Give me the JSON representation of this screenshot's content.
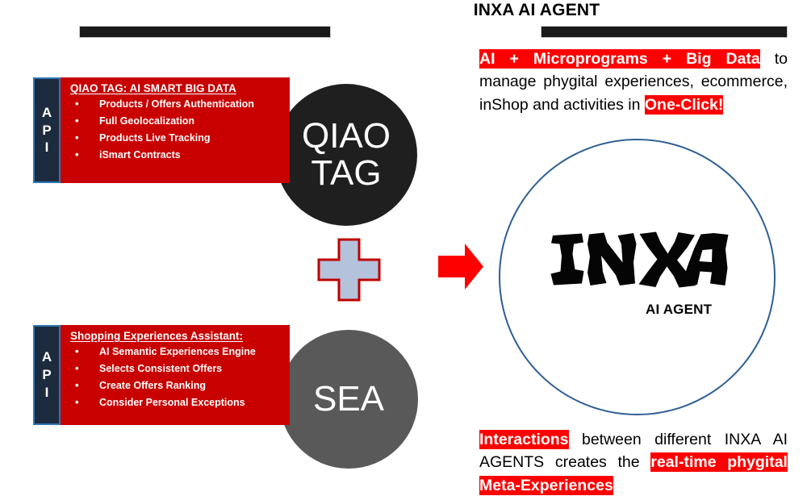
{
  "header": {
    "title": "INXA AI AGENT"
  },
  "left_column": {
    "blocks": [
      {
        "api_label_letters": [
          "A",
          "P",
          "I"
        ],
        "heading": "QIAO TAG: AI SMART BIG DATA",
        "bullets": [
          "Products / Offers Authentication",
          "Full Geolocalization",
          "Products Live Tracking",
          "iSmart Contracts"
        ],
        "circle": {
          "line1": "QIAO",
          "line2": "TAG",
          "color": "#1f1f1f"
        }
      },
      {
        "api_label_letters": [
          "A",
          "P",
          "I"
        ],
        "heading": "Shopping Experiences Assistant:",
        "bullets": [
          "AI Semantic Experiences Engine",
          "Selects Consistent Offers",
          "Create Offers Ranking",
          "Consider Personal Exceptions"
        ],
        "circle": {
          "line1": "SEA",
          "line2": "",
          "color": "#595959"
        }
      }
    ],
    "operator": "plus",
    "connector": "right-arrow"
  },
  "right_column": {
    "paragraph_top": {
      "segments": [
        {
          "text": "AI + Microprograms + Big Data",
          "highlight": true
        },
        {
          "text": " to manage phygital experiences, ecommerce, inShop and activities in ",
          "highlight": false
        },
        {
          "text": "One-Click!",
          "highlight": true
        }
      ]
    },
    "paragraph_bottom": {
      "segments": [
        {
          "text": "Interactions",
          "highlight": true
        },
        {
          "text": " between different INXA AI AGENTS creates the ",
          "highlight": false
        },
        {
          "text": "real-time phygital Meta-Experiences",
          "highlight": true
        }
      ]
    },
    "logo": {
      "wordmark": "INXA",
      "subtitle": "AI AGENT",
      "circle_stroke": "#2e5f94"
    }
  },
  "colors": {
    "red_panel": "#c80000",
    "highlight_red": "#ff0000",
    "api_navy": "#1d2b3e",
    "api_border_blue": "#2e75b6",
    "plus_fill": "#b4c2dc",
    "plus_stroke": "#c00000",
    "arrow_red": "#ff0000",
    "rule_black": "#1a1a1a",
    "circle_dark": "#1f1f1f",
    "circle_gray": "#595959"
  }
}
